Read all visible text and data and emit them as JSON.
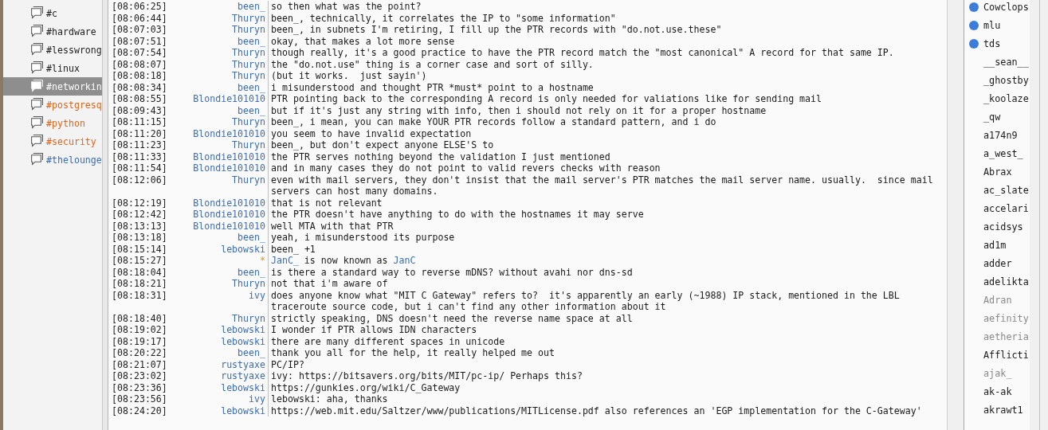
{
  "channels": [
    {
      "name": "#c",
      "selected": false,
      "color": "#1e1e1e"
    },
    {
      "name": "#hardware",
      "selected": false,
      "color": "#1e1e1e"
    },
    {
      "name": "#lesswrong",
      "selected": false,
      "color": "#1e1e1e"
    },
    {
      "name": "#linux",
      "selected": false,
      "color": "#1e1e1e"
    },
    {
      "name": "#networkin",
      "selected": true
    },
    {
      "name": "#postgresq",
      "selected": false,
      "color": "#e0651c"
    },
    {
      "name": "#python",
      "selected": false,
      "color": "#e0651c"
    },
    {
      "name": "#security",
      "selected": false,
      "color": "#e0651c"
    },
    {
      "name": "#thelounge",
      "selected": false,
      "color": "#3a6db5"
    }
  ],
  "messages": [
    {
      "kind": "message",
      "time": "[08:06:25]",
      "nick": "been_",
      "text": "so then what was the point?"
    },
    {
      "kind": "message",
      "time": "[08:06:44]",
      "nick": "Thuryn",
      "text": "been_, technically, it correlates the IP to \"some information\""
    },
    {
      "kind": "message",
      "time": "[08:07:03]",
      "nick": "Thuryn",
      "text": "been_, in subnets I'm retiring, I fill up the PTR records with \"do.not.use.these\""
    },
    {
      "kind": "message",
      "time": "[08:07:51]",
      "nick": "been_",
      "text": "okay, that makes a lot more sense"
    },
    {
      "kind": "message",
      "time": "[08:07:54]",
      "nick": "Thuryn",
      "text": "though really, it's a good practice to have the PTR record match the \"most canonical\" A record for that same IP."
    },
    {
      "kind": "message",
      "time": "[08:08:07]",
      "nick": "Thuryn",
      "text": "the \"do.not.use\" thing is a corner case and sort of silly."
    },
    {
      "kind": "message",
      "time": "[08:08:18]",
      "nick": "Thuryn",
      "text": "(but it works.  just sayin')"
    },
    {
      "kind": "message",
      "time": "[08:08:34]",
      "nick": "been_",
      "text": "i misunderstood and thought PTR *must* point to a hostname"
    },
    {
      "kind": "message",
      "time": "[08:08:55]",
      "nick": "Blondie101010",
      "text": "PTR pointing back to the corresponding A record is only needed for valiations like for sending mail"
    },
    {
      "kind": "message",
      "time": "[08:09:43]",
      "nick": "been_",
      "text": "but if it's just any string with info, then i should not rely on it for a proper hostname"
    },
    {
      "kind": "message",
      "time": "[08:11:15]",
      "nick": "Thuryn",
      "text": "been_, i mean, you can make YOUR PTR records follow a standard pattern, and i do"
    },
    {
      "kind": "message",
      "time": "[08:11:20]",
      "nick": "Blondie101010",
      "text": "you seem to have invalid expectation"
    },
    {
      "kind": "message",
      "time": "[08:11:23]",
      "nick": "Thuryn",
      "text": "been_, but don't expect anyone ELSE'S to"
    },
    {
      "kind": "message",
      "time": "[08:11:33]",
      "nick": "Blondie101010",
      "text": "the PTR serves nothing beyond the validation I just mentioned"
    },
    {
      "kind": "message",
      "time": "[08:11:54]",
      "nick": "Blondie101010",
      "text": "and in many cases they do not point to valid revers checks with reason"
    },
    {
      "kind": "message",
      "time": "[08:12:06]",
      "nick": "Thuryn",
      "text": "even with mail servers, they don't insist that the mail server's PTR matches the mail server name. usually.  since mail servers can host many domains."
    },
    {
      "kind": "message",
      "time": "[08:12:19]",
      "nick": "Blondie101010",
      "text": "that is not relevant"
    },
    {
      "kind": "message",
      "time": "[08:12:42]",
      "nick": "Blondie101010",
      "text": "the PTR doesn't have anything to do with the hostnames it may serve"
    },
    {
      "kind": "message",
      "time": "[08:13:13]",
      "nick": "Blondie101010",
      "text": "well MTA with that PTR"
    },
    {
      "kind": "message",
      "time": "[08:13:18]",
      "nick": "been_",
      "text": "yeah, i misunderstood its purpose"
    },
    {
      "kind": "message",
      "time": "[08:15:14]",
      "nick": "lebowski",
      "text": "been_ +1"
    },
    {
      "kind": "nick_change",
      "time": "[08:15:27]",
      "nick": "*",
      "old_nick": "JanC_",
      "text": "is now known as",
      "new_nick": "JanC"
    },
    {
      "kind": "message",
      "time": "[08:18:04]",
      "nick": "been_",
      "text": "is there a standard way to reverse mDNS? without avahi nor dns-sd"
    },
    {
      "kind": "message",
      "time": "[08:18:21]",
      "nick": "Thuryn",
      "text": "not that i'm aware of"
    },
    {
      "kind": "message",
      "time": "[08:18:31]",
      "nick": "ivy",
      "text": "does anyone know what \"MIT C Gateway\" refers to?  it's apparently an early (~1988) IP stack, mentioned in the LBL traceroute source code, but i can't find any other information about it"
    },
    {
      "kind": "message",
      "time": "[08:18:40]",
      "nick": "Thuryn",
      "text": "strictly speaking, DNS doesn't need the reverse name space at all"
    },
    {
      "kind": "message",
      "time": "[08:19:02]",
      "nick": "lebowski",
      "text": "I wonder if PTR allows IDN characters"
    },
    {
      "kind": "message",
      "time": "[08:19:17]",
      "nick": "lebowski",
      "text": "there are many different spaces in unicode"
    },
    {
      "kind": "message",
      "time": "[08:20:22]",
      "nick": "been_",
      "text": "thank you all for the help, it really helped me out"
    },
    {
      "kind": "message",
      "time": "[08:21:07]",
      "nick": "rustyaxe",
      "text": "PC/IP?"
    },
    {
      "kind": "message",
      "time": "[08:23:02]",
      "nick": "rustyaxe",
      "text": "ivy: https://bitsavers.org/bits/MIT/pc-ip/ Perhaps this?"
    },
    {
      "kind": "message",
      "time": "[08:23:36]",
      "nick": "lebowski",
      "text": "https://gunkies.org/wiki/C_Gateway"
    },
    {
      "kind": "message",
      "time": "[08:23:56]",
      "nick": "ivy",
      "text": "lebowski: aha, thanks"
    },
    {
      "kind": "message",
      "time": "[08:24:20]",
      "nick": "lebowski",
      "text": "https://web.mit.edu/Saltzer/www/publications/MITLicense.pdf also references an 'EGP implementation for the C-Gateway'"
    }
  ],
  "users": [
    {
      "name": "Cowclops",
      "voiced": true,
      "away": false
    },
    {
      "name": "mlu",
      "voiced": true,
      "away": false
    },
    {
      "name": "tds",
      "voiced": true,
      "away": false
    },
    {
      "name": "__sean__",
      "voiced": false,
      "away": false
    },
    {
      "name": "_ghostby",
      "voiced": false,
      "away": false
    },
    {
      "name": "_koolaze",
      "voiced": false,
      "away": false
    },
    {
      "name": "_qw",
      "voiced": false,
      "away": false
    },
    {
      "name": "a174n9",
      "voiced": false,
      "away": false
    },
    {
      "name": "a_west_",
      "voiced": false,
      "away": false
    },
    {
      "name": "Abrax",
      "voiced": false,
      "away": false
    },
    {
      "name": "ac_slate",
      "voiced": false,
      "away": false
    },
    {
      "name": "accelari",
      "voiced": false,
      "away": false
    },
    {
      "name": "acidsys",
      "voiced": false,
      "away": false
    },
    {
      "name": "ad1m",
      "voiced": false,
      "away": false
    },
    {
      "name": "adder",
      "voiced": false,
      "away": false
    },
    {
      "name": "adelikta",
      "voiced": false,
      "away": false
    },
    {
      "name": "Adran",
      "voiced": false,
      "away": true
    },
    {
      "name": "aefinity",
      "voiced": false,
      "away": true
    },
    {
      "name": "aetheria",
      "voiced": false,
      "away": true
    },
    {
      "name": "Afflicti",
      "voiced": false,
      "away": false
    },
    {
      "name": "ajak_",
      "voiced": false,
      "away": true
    },
    {
      "name": "ak-ak",
      "voiced": false,
      "away": false
    },
    {
      "name": "akrawt1",
      "voiced": false,
      "away": false
    }
  ]
}
